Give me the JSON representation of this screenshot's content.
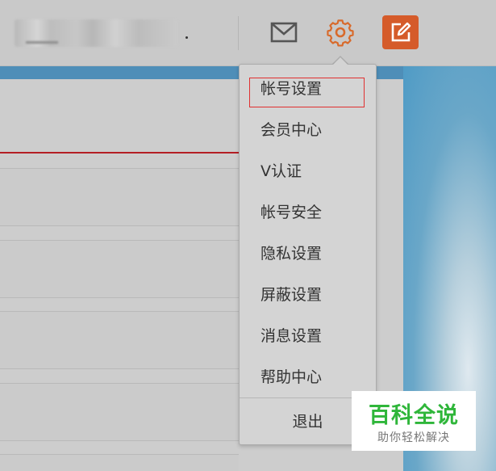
{
  "header": {
    "username_blurred": "",
    "icons": [
      "envelope-icon",
      "gear-icon",
      "edit-icon"
    ],
    "colors": {
      "gear": "#d86a2b",
      "edit_button": "#d55b2a",
      "envelope": "#555555"
    }
  },
  "settings_menu": {
    "items": [
      {
        "label": "帐号设置"
      },
      {
        "label": "会员中心"
      },
      {
        "label": "V认证"
      },
      {
        "label": "帐号安全"
      },
      {
        "label": "隐私设置"
      },
      {
        "label": "屏蔽设置"
      },
      {
        "label": "消息设置"
      },
      {
        "label": "帮助中心"
      }
    ],
    "logout_label": "退出",
    "highlighted_item": "帐号设置",
    "highlight_color": "#e03030"
  },
  "watermark": {
    "title": "百科全说",
    "subtitle": "助你轻松解决",
    "color": "#2fb63a"
  }
}
